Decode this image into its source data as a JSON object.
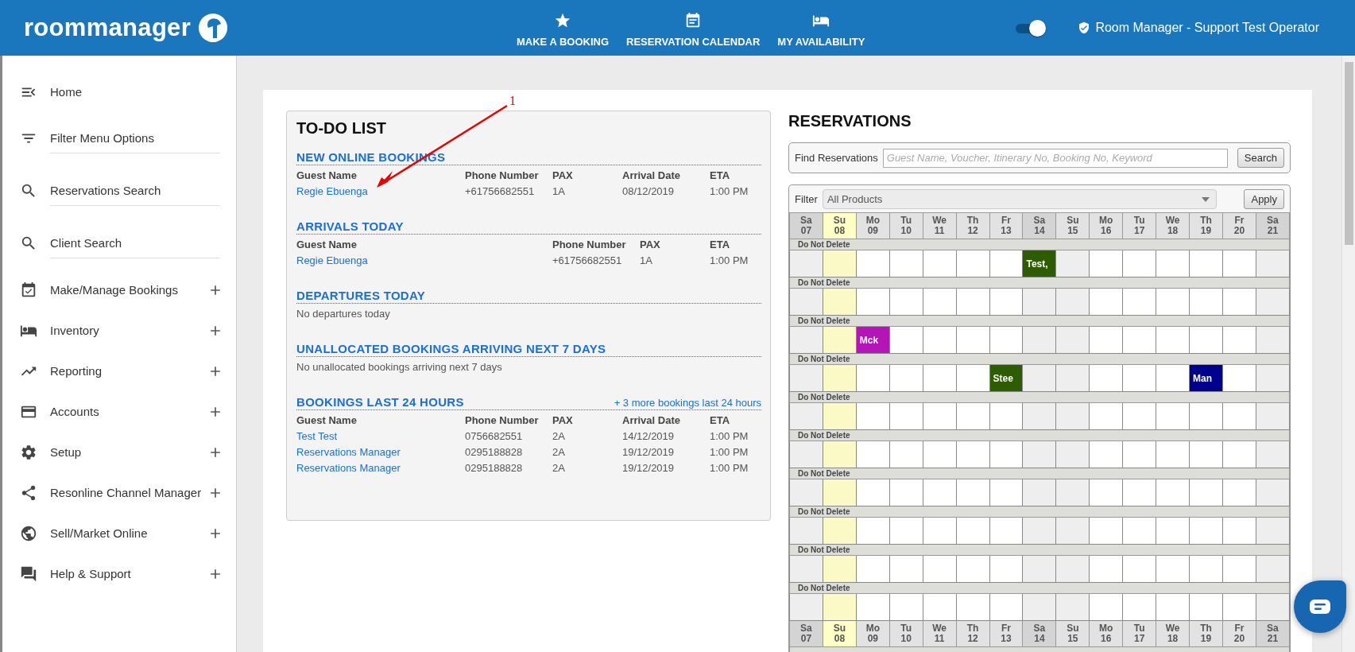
{
  "header": {
    "logo": "roommanager",
    "nav": [
      {
        "label": "MAKE A BOOKING"
      },
      {
        "label": "RESERVATION CALENDAR"
      },
      {
        "label": "MY AVAILABILITY"
      }
    ],
    "switch_on": true,
    "user": "Room Manager - Support Test Operator"
  },
  "sidebar": {
    "items": [
      {
        "kind": "link",
        "label": "Home"
      },
      {
        "kind": "field",
        "placeholder": "Filter Menu Options"
      },
      {
        "kind": "field",
        "placeholder": "Reservations Search"
      },
      {
        "kind": "field",
        "placeholder": "Client Search"
      },
      {
        "kind": "group",
        "label": "Make/Manage Bookings",
        "expanded": false
      },
      {
        "kind": "group",
        "label": "Inventory",
        "expanded": false
      },
      {
        "kind": "group",
        "label": "Reporting",
        "expanded": false
      },
      {
        "kind": "group",
        "label": "Accounts",
        "expanded": false
      },
      {
        "kind": "group",
        "label": "Setup",
        "expanded": false
      },
      {
        "kind": "group",
        "label": "Resonline Channel Manager",
        "expanded": false
      },
      {
        "kind": "group",
        "label": "Sell/Market Online",
        "expanded": false
      },
      {
        "kind": "group",
        "label": "Help & Support",
        "expanded": false
      }
    ]
  },
  "todo": {
    "title": "TO-DO LIST",
    "sections": [
      {
        "title": "NEW ONLINE BOOKINGS",
        "columns": [
          "Guest Name",
          "Phone Number",
          "PAX",
          "Arrival Date",
          "ETA"
        ],
        "rows": [
          [
            "Regie Ebuenga",
            "+61756682551",
            "1A",
            "08/12/2019",
            "1:00 PM"
          ]
        ]
      },
      {
        "title": "ARRIVALS TODAY",
        "columns": [
          "Guest Name",
          "Phone Number",
          "PAX",
          "ETA"
        ],
        "rows": [
          [
            "Regie Ebuenga",
            "+61756682551",
            "1A",
            "1:00 PM"
          ]
        ]
      },
      {
        "title": "DEPARTURES TODAY",
        "empty_text": "No departures today"
      },
      {
        "title": "UNALLOCATED BOOKINGS ARRIVING NEXT 7 DAYS",
        "empty_text": "No unallocated bookings arriving next 7 days"
      },
      {
        "title": "BOOKINGS LAST 24 HOURS",
        "link": "+ 3 more bookings last 24 hours",
        "columns": [
          "Guest Name",
          "Phone Number",
          "PAX",
          "Arrival Date",
          "ETA"
        ],
        "rows": [
          [
            "Test Test",
            "0756682551",
            "2A",
            "14/12/2019",
            "1:00 PM"
          ],
          [
            "Reservations Manager",
            "0295188828",
            "2A",
            "19/12/2019",
            "1:00 PM"
          ],
          [
            "Reservations Manager",
            "0295188828",
            "2A",
            "19/12/2019",
            "1:00 PM"
          ]
        ]
      }
    ]
  },
  "annotation": {
    "label": "1"
  },
  "reservations": {
    "title": "RESERVATIONS",
    "find_label": "Find Reservations",
    "find_placeholder": "Guest Name, Voucher, Itinerary No, Booking No, Keyword",
    "search_button": "Search",
    "filter_label": "Filter",
    "filter_value": "All Products",
    "apply_button": "Apply",
    "calendar": [
      {
        "kind": "days",
        "days": [
          {
            "dow": "Sa",
            "date": "07",
            "kind": "saturday"
          },
          {
            "dow": "Su",
            "date": "08",
            "kind": "today"
          },
          {
            "dow": "Mo",
            "date": "09",
            "kind": "weekday"
          },
          {
            "dow": "Tu",
            "date": "10",
            "kind": "weekday"
          },
          {
            "dow": "We",
            "date": "11",
            "kind": "weekday"
          },
          {
            "dow": "Th",
            "date": "12",
            "kind": "weekday"
          },
          {
            "dow": "Fr",
            "date": "13",
            "kind": "weekday"
          },
          {
            "dow": "Sa",
            "date": "14",
            "kind": "saturday"
          },
          {
            "dow": "Su",
            "date": "15",
            "kind": "sunday"
          },
          {
            "dow": "Mo",
            "date": "16",
            "kind": "weekday"
          },
          {
            "dow": "Tu",
            "date": "17",
            "kind": "weekday"
          },
          {
            "dow": "We",
            "date": "18",
            "kind": "weekday"
          },
          {
            "dow": "Th",
            "date": "19",
            "kind": "weekday"
          },
          {
            "dow": "Fr",
            "date": "20",
            "kind": "weekday"
          },
          {
            "dow": "Sa",
            "date": "21",
            "kind": "saturday"
          }
        ]
      },
      {
        "kind": "room",
        "label": "Do Not Delete",
        "cells": [
          {
            "kind": "free"
          },
          {
            "kind": "free"
          },
          {
            "kind": "free"
          },
          {
            "kind": "free"
          },
          {
            "kind": "free"
          },
          {
            "kind": "free"
          },
          {
            "kind": "free"
          },
          {
            "kind": "booking",
            "text": "Test,",
            "color": "#2d5d00"
          },
          {
            "kind": "free"
          },
          {
            "kind": "free"
          },
          {
            "kind": "free"
          },
          {
            "kind": "free"
          },
          {
            "kind": "free"
          },
          {
            "kind": "free"
          },
          {
            "kind": "free"
          }
        ]
      },
      {
        "kind": "room",
        "label": "Do Not Delete",
        "cells": [
          {
            "kind": "free"
          },
          {
            "kind": "free"
          },
          {
            "kind": "free"
          },
          {
            "kind": "free"
          },
          {
            "kind": "free"
          },
          {
            "kind": "free"
          },
          {
            "kind": "free"
          },
          {
            "kind": "free"
          },
          {
            "kind": "free"
          },
          {
            "kind": "free"
          },
          {
            "kind": "free"
          },
          {
            "kind": "free"
          },
          {
            "kind": "free"
          },
          {
            "kind": "free"
          },
          {
            "kind": "free"
          }
        ]
      },
      {
        "kind": "room",
        "label": "Do Not Delete",
        "cells": [
          {
            "kind": "free"
          },
          {
            "kind": "free"
          },
          {
            "kind": "booking",
            "text": "Mck",
            "color": "#b514b9"
          },
          {
            "kind": "free"
          },
          {
            "kind": "free"
          },
          {
            "kind": "free"
          },
          {
            "kind": "free"
          },
          {
            "kind": "free"
          },
          {
            "kind": "free"
          },
          {
            "kind": "free"
          },
          {
            "kind": "free"
          },
          {
            "kind": "free"
          },
          {
            "kind": "free"
          },
          {
            "kind": "free"
          },
          {
            "kind": "free"
          }
        ]
      },
      {
        "kind": "room",
        "label": "Do Not Delete",
        "cells": [
          {
            "kind": "free"
          },
          {
            "kind": "free"
          },
          {
            "kind": "free"
          },
          {
            "kind": "free"
          },
          {
            "kind": "free"
          },
          {
            "kind": "free"
          },
          {
            "kind": "booking",
            "text": "Stee",
            "color": "#2d5d00"
          },
          {
            "kind": "free"
          },
          {
            "kind": "free"
          },
          {
            "kind": "free"
          },
          {
            "kind": "free"
          },
          {
            "kind": "free"
          },
          {
            "kind": "booking",
            "text": "Man",
            "color": "#000090"
          },
          {
            "kind": "free"
          },
          {
            "kind": "free"
          }
        ]
      },
      {
        "kind": "room",
        "label": "Do Not Delete",
        "cells": [
          {
            "kind": "free"
          },
          {
            "kind": "free"
          },
          {
            "kind": "free"
          },
          {
            "kind": "free"
          },
          {
            "kind": "free"
          },
          {
            "kind": "free"
          },
          {
            "kind": "free"
          },
          {
            "kind": "free"
          },
          {
            "kind": "free"
          },
          {
            "kind": "free"
          },
          {
            "kind": "free"
          },
          {
            "kind": "free"
          },
          {
            "kind": "free"
          },
          {
            "kind": "free"
          },
          {
            "kind": "free"
          }
        ]
      },
      {
        "kind": "room",
        "label": "Do Not Delete",
        "cells": [
          {
            "kind": "free"
          },
          {
            "kind": "free"
          },
          {
            "kind": "free"
          },
          {
            "kind": "free"
          },
          {
            "kind": "free"
          },
          {
            "kind": "free"
          },
          {
            "kind": "free"
          },
          {
            "kind": "free"
          },
          {
            "kind": "free"
          },
          {
            "kind": "free"
          },
          {
            "kind": "free"
          },
          {
            "kind": "free"
          },
          {
            "kind": "free"
          },
          {
            "kind": "free"
          },
          {
            "kind": "free"
          }
        ]
      },
      {
        "kind": "room",
        "label": "Do Not Delete",
        "cells": [
          {
            "kind": "free"
          },
          {
            "kind": "free"
          },
          {
            "kind": "free"
          },
          {
            "kind": "free"
          },
          {
            "kind": "free"
          },
          {
            "kind": "free"
          },
          {
            "kind": "free"
          },
          {
            "kind": "free"
          },
          {
            "kind": "free"
          },
          {
            "kind": "free"
          },
          {
            "kind": "free"
          },
          {
            "kind": "free"
          },
          {
            "kind": "free"
          },
          {
            "kind": "free"
          },
          {
            "kind": "free"
          }
        ]
      },
      {
        "kind": "room",
        "label": "Do Not Delete",
        "cells": [
          {
            "kind": "free"
          },
          {
            "kind": "free"
          },
          {
            "kind": "free"
          },
          {
            "kind": "free"
          },
          {
            "kind": "free"
          },
          {
            "kind": "free"
          },
          {
            "kind": "free"
          },
          {
            "kind": "free"
          },
          {
            "kind": "free"
          },
          {
            "kind": "free"
          },
          {
            "kind": "free"
          },
          {
            "kind": "free"
          },
          {
            "kind": "free"
          },
          {
            "kind": "free"
          },
          {
            "kind": "free"
          }
        ]
      },
      {
        "kind": "room",
        "label": "Do Not Delete",
        "cells": [
          {
            "kind": "free"
          },
          {
            "kind": "free"
          },
          {
            "kind": "free"
          },
          {
            "kind": "free"
          },
          {
            "kind": "free"
          },
          {
            "kind": "free"
          },
          {
            "kind": "free"
          },
          {
            "kind": "free"
          },
          {
            "kind": "free"
          },
          {
            "kind": "free"
          },
          {
            "kind": "free"
          },
          {
            "kind": "free"
          },
          {
            "kind": "free"
          },
          {
            "kind": "free"
          },
          {
            "kind": "free"
          }
        ]
      },
      {
        "kind": "room",
        "label": "Do Not Delete",
        "cells": [
          {
            "kind": "free"
          },
          {
            "kind": "free"
          },
          {
            "kind": "free"
          },
          {
            "kind": "free"
          },
          {
            "kind": "free"
          },
          {
            "kind": "free"
          },
          {
            "kind": "free"
          },
          {
            "kind": "free"
          },
          {
            "kind": "free"
          },
          {
            "kind": "free"
          },
          {
            "kind": "free"
          },
          {
            "kind": "free"
          },
          {
            "kind": "free"
          },
          {
            "kind": "free"
          },
          {
            "kind": "free"
          }
        ]
      },
      {
        "kind": "days",
        "days": [
          {
            "dow": "Sa",
            "date": "07",
            "kind": "saturday"
          },
          {
            "dow": "Su",
            "date": "08",
            "kind": "today"
          },
          {
            "dow": "Mo",
            "date": "09",
            "kind": "weekday"
          },
          {
            "dow": "Tu",
            "date": "10",
            "kind": "weekday"
          },
          {
            "dow": "We",
            "date": "11",
            "kind": "weekday"
          },
          {
            "dow": "Th",
            "date": "12",
            "kind": "weekday"
          },
          {
            "dow": "Fr",
            "date": "13",
            "kind": "weekday"
          },
          {
            "dow": "Sa",
            "date": "14",
            "kind": "saturday"
          },
          {
            "dow": "Su",
            "date": "15",
            "kind": "sunday"
          },
          {
            "dow": "Mo",
            "date": "16",
            "kind": "weekday"
          },
          {
            "dow": "Tu",
            "date": "17",
            "kind": "weekday"
          },
          {
            "dow": "We",
            "date": "18",
            "kind": "weekday"
          },
          {
            "dow": "Th",
            "date": "19",
            "kind": "weekday"
          },
          {
            "dow": "Fr",
            "date": "20",
            "kind": "weekday"
          },
          {
            "dow": "Sa",
            "date": "21",
            "kind": "saturday"
          }
        ]
      },
      {
        "kind": "stub"
      }
    ]
  }
}
